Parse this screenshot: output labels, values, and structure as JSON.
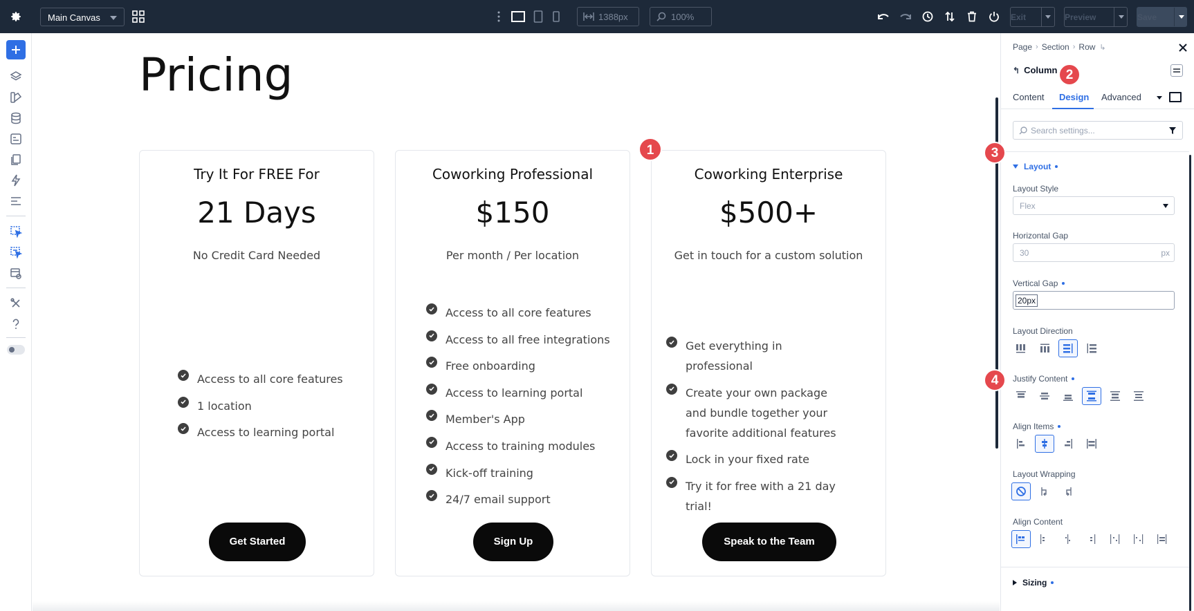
{
  "topbar": {
    "canvas_select": "Main Canvas",
    "width_value": "1388px",
    "zoom_value": "100%",
    "exit_label": "Exit",
    "preview_label": "Preview",
    "save_label": "Save"
  },
  "canvas": {
    "page_title": "Pricing",
    "cards": [
      {
        "title": "Try It For FREE For",
        "price": "21 Days",
        "subtitle": "No Credit Card Needed",
        "features": [
          "Access to all core features",
          "1 location",
          "Access to learning portal"
        ],
        "button": "Get Started"
      },
      {
        "title": "Coworking Professional",
        "price": "$150",
        "subtitle": "Per month / Per location",
        "features": [
          "Access to all core features",
          "Access to all free integrations",
          "Free onboarding",
          "Access to learning portal",
          "Member's App",
          "Access to training modules",
          "Kick-off training",
          "24/7 email support"
        ],
        "button": "Sign Up"
      },
      {
        "title": "Coworking Enterprise",
        "price": "$500+",
        "subtitle": "Get in touch for a custom solution",
        "features": [
          "Get everything in professional",
          "Create your own package and bundle together your favorite additional features",
          "Lock in your fixed rate",
          "Try it for free with a 21 day trial!"
        ],
        "button": "Speak to the Team"
      }
    ]
  },
  "markers": [
    "1",
    "2",
    "3",
    "4"
  ],
  "panel": {
    "breadcrumb": [
      "Page",
      "Section",
      "Row"
    ],
    "element": "Column",
    "tabs": [
      "Content",
      "Design",
      "Advanced"
    ],
    "active_tab": "Design",
    "search_placeholder": "Search settings...",
    "layout_section": "Layout",
    "layout_style_label": "Layout Style",
    "layout_style_value": "Flex",
    "hgap_label": "Horizontal Gap",
    "hgap_value": "30",
    "hgap_unit": "px",
    "vgap_label": "Vertical Gap",
    "vgap_value": "20px",
    "direction_label": "Layout Direction",
    "justify_label": "Justify Content",
    "align_items_label": "Align Items",
    "wrapping_label": "Layout Wrapping",
    "align_content_label": "Align Content",
    "sizing_section": "Sizing"
  },
  "colors": {
    "accent": "#2f6fe4",
    "topbar": "#1d2939",
    "marker": "#e5484d"
  }
}
